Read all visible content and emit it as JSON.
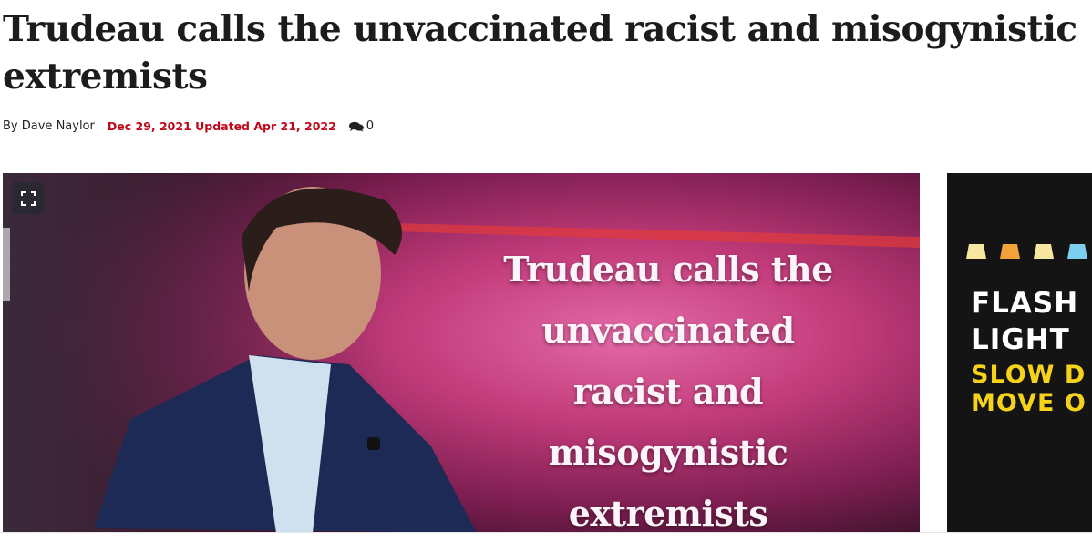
{
  "article": {
    "headline": "Trudeau calls the unvaccinated racist and misogynistic extremists",
    "byline_prefix": "By",
    "author": "Dave Naylor",
    "dates": "Dec 29, 2021 Updated Apr 21, 2022",
    "comment_count": "0"
  },
  "media": {
    "overlay_lines": [
      "Trudeau calls the",
      "unvaccinated",
      "racist and",
      "misogynistic",
      "extremists"
    ],
    "expand_icon": "expand-icon",
    "bg_colors": [
      "#2a1020",
      "#7a1d4f",
      "#c23b7a",
      "#e46aa8"
    ]
  },
  "ad": {
    "line1": "FLASH",
    "line2": "LIGHT",
    "line3": "SLOW D",
    "line4": "MOVE O",
    "accent": "#f6d21a"
  },
  "colors": {
    "headline": "#1c1c1c",
    "date_red": "#c0071b"
  }
}
